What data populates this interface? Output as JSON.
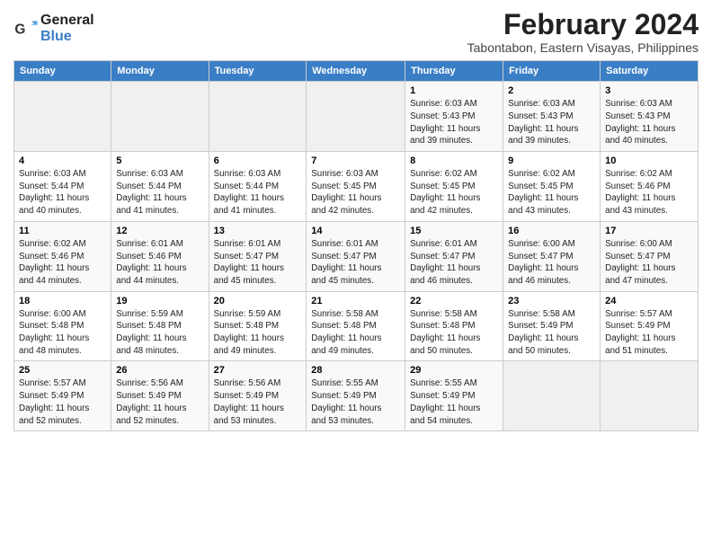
{
  "header": {
    "logo_line1": "General",
    "logo_line2": "Blue",
    "main_title": "February 2024",
    "sub_title": "Tabontabon, Eastern Visayas, Philippines"
  },
  "days_of_week": [
    "Sunday",
    "Monday",
    "Tuesday",
    "Wednesday",
    "Thursday",
    "Friday",
    "Saturday"
  ],
  "weeks": [
    [
      {
        "day": "",
        "info": ""
      },
      {
        "day": "",
        "info": ""
      },
      {
        "day": "",
        "info": ""
      },
      {
        "day": "",
        "info": ""
      },
      {
        "day": "1",
        "info": "Sunrise: 6:03 AM\nSunset: 5:43 PM\nDaylight: 11 hours\nand 39 minutes."
      },
      {
        "day": "2",
        "info": "Sunrise: 6:03 AM\nSunset: 5:43 PM\nDaylight: 11 hours\nand 39 minutes."
      },
      {
        "day": "3",
        "info": "Sunrise: 6:03 AM\nSunset: 5:43 PM\nDaylight: 11 hours\nand 40 minutes."
      }
    ],
    [
      {
        "day": "4",
        "info": "Sunrise: 6:03 AM\nSunset: 5:44 PM\nDaylight: 11 hours\nand 40 minutes."
      },
      {
        "day": "5",
        "info": "Sunrise: 6:03 AM\nSunset: 5:44 PM\nDaylight: 11 hours\nand 41 minutes."
      },
      {
        "day": "6",
        "info": "Sunrise: 6:03 AM\nSunset: 5:44 PM\nDaylight: 11 hours\nand 41 minutes."
      },
      {
        "day": "7",
        "info": "Sunrise: 6:03 AM\nSunset: 5:45 PM\nDaylight: 11 hours\nand 42 minutes."
      },
      {
        "day": "8",
        "info": "Sunrise: 6:02 AM\nSunset: 5:45 PM\nDaylight: 11 hours\nand 42 minutes."
      },
      {
        "day": "9",
        "info": "Sunrise: 6:02 AM\nSunset: 5:45 PM\nDaylight: 11 hours\nand 43 minutes."
      },
      {
        "day": "10",
        "info": "Sunrise: 6:02 AM\nSunset: 5:46 PM\nDaylight: 11 hours\nand 43 minutes."
      }
    ],
    [
      {
        "day": "11",
        "info": "Sunrise: 6:02 AM\nSunset: 5:46 PM\nDaylight: 11 hours\nand 44 minutes."
      },
      {
        "day": "12",
        "info": "Sunrise: 6:01 AM\nSunset: 5:46 PM\nDaylight: 11 hours\nand 44 minutes."
      },
      {
        "day": "13",
        "info": "Sunrise: 6:01 AM\nSunset: 5:47 PM\nDaylight: 11 hours\nand 45 minutes."
      },
      {
        "day": "14",
        "info": "Sunrise: 6:01 AM\nSunset: 5:47 PM\nDaylight: 11 hours\nand 45 minutes."
      },
      {
        "day": "15",
        "info": "Sunrise: 6:01 AM\nSunset: 5:47 PM\nDaylight: 11 hours\nand 46 minutes."
      },
      {
        "day": "16",
        "info": "Sunrise: 6:00 AM\nSunset: 5:47 PM\nDaylight: 11 hours\nand 46 minutes."
      },
      {
        "day": "17",
        "info": "Sunrise: 6:00 AM\nSunset: 5:47 PM\nDaylight: 11 hours\nand 47 minutes."
      }
    ],
    [
      {
        "day": "18",
        "info": "Sunrise: 6:00 AM\nSunset: 5:48 PM\nDaylight: 11 hours\nand 48 minutes."
      },
      {
        "day": "19",
        "info": "Sunrise: 5:59 AM\nSunset: 5:48 PM\nDaylight: 11 hours\nand 48 minutes."
      },
      {
        "day": "20",
        "info": "Sunrise: 5:59 AM\nSunset: 5:48 PM\nDaylight: 11 hours\nand 49 minutes."
      },
      {
        "day": "21",
        "info": "Sunrise: 5:58 AM\nSunset: 5:48 PM\nDaylight: 11 hours\nand 49 minutes."
      },
      {
        "day": "22",
        "info": "Sunrise: 5:58 AM\nSunset: 5:48 PM\nDaylight: 11 hours\nand 50 minutes."
      },
      {
        "day": "23",
        "info": "Sunrise: 5:58 AM\nSunset: 5:49 PM\nDaylight: 11 hours\nand 50 minutes."
      },
      {
        "day": "24",
        "info": "Sunrise: 5:57 AM\nSunset: 5:49 PM\nDaylight: 11 hours\nand 51 minutes."
      }
    ],
    [
      {
        "day": "25",
        "info": "Sunrise: 5:57 AM\nSunset: 5:49 PM\nDaylight: 11 hours\nand 52 minutes."
      },
      {
        "day": "26",
        "info": "Sunrise: 5:56 AM\nSunset: 5:49 PM\nDaylight: 11 hours\nand 52 minutes."
      },
      {
        "day": "27",
        "info": "Sunrise: 5:56 AM\nSunset: 5:49 PM\nDaylight: 11 hours\nand 53 minutes."
      },
      {
        "day": "28",
        "info": "Sunrise: 5:55 AM\nSunset: 5:49 PM\nDaylight: 11 hours\nand 53 minutes."
      },
      {
        "day": "29",
        "info": "Sunrise: 5:55 AM\nSunset: 5:49 PM\nDaylight: 11 hours\nand 54 minutes."
      },
      {
        "day": "",
        "info": ""
      },
      {
        "day": "",
        "info": ""
      }
    ]
  ]
}
